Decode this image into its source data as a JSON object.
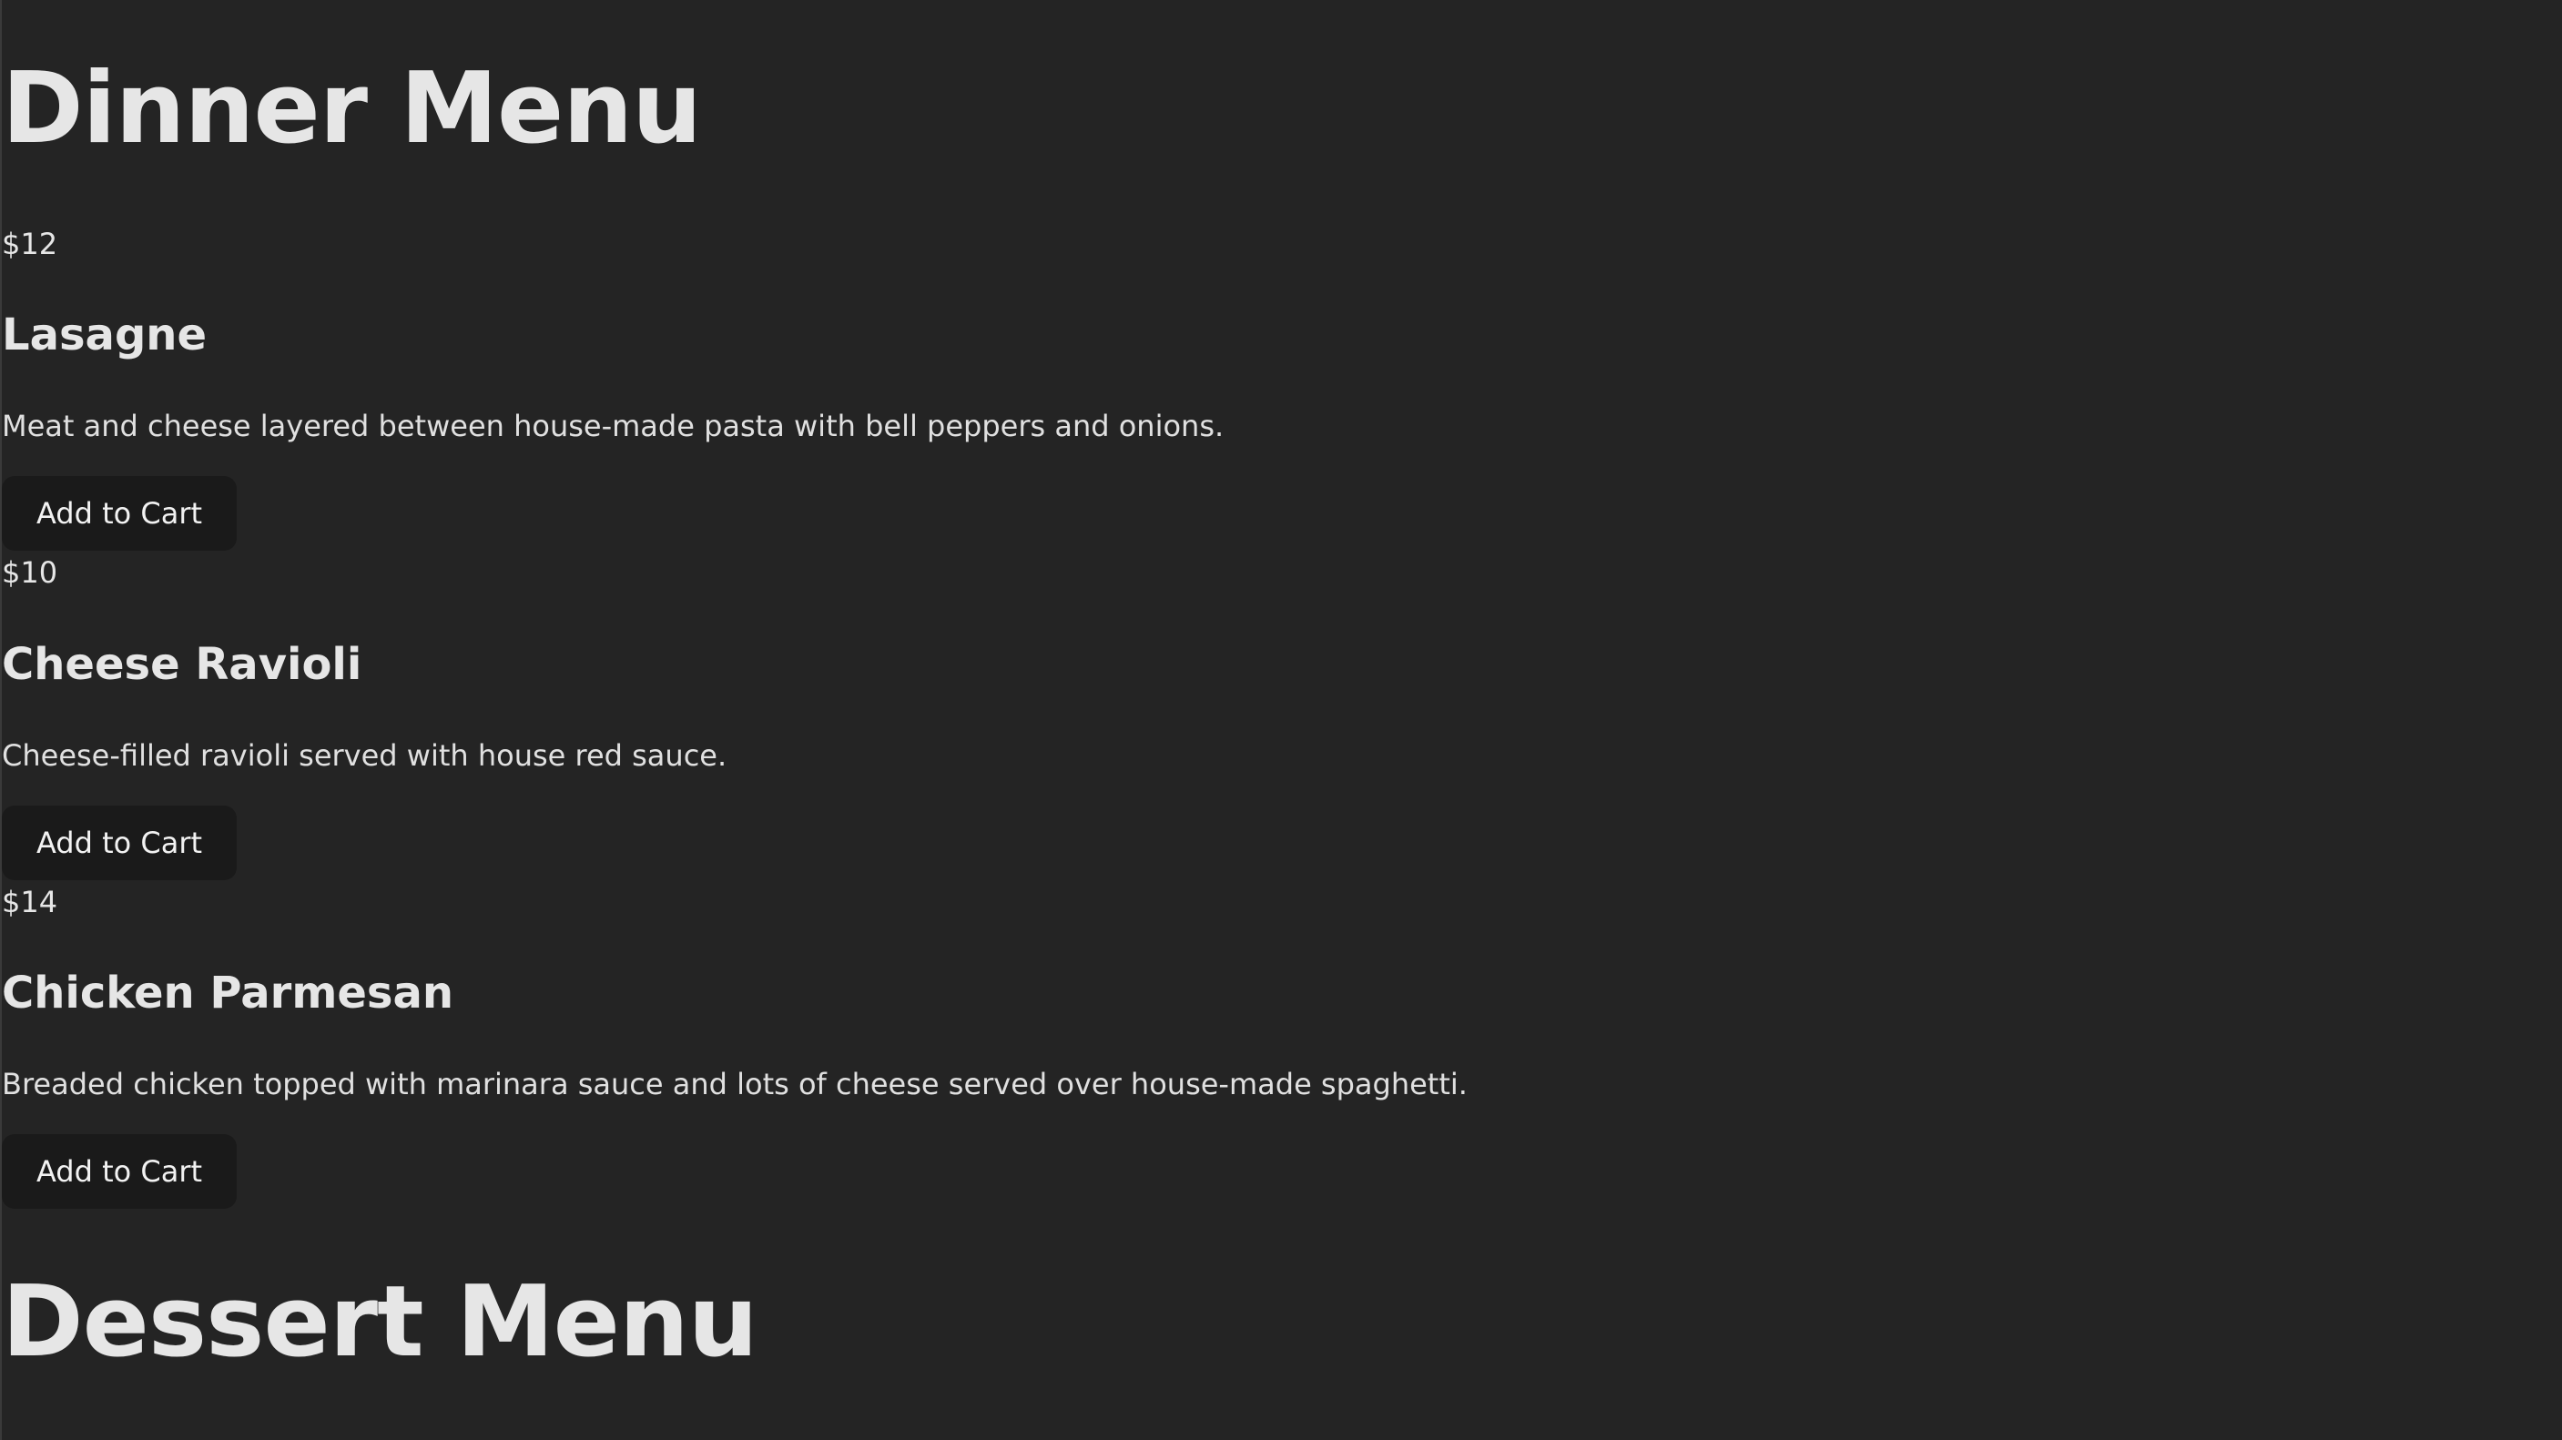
{
  "dinner_menu": {
    "title": "Dinner Menu",
    "items": [
      {
        "price": "$12",
        "name": "Lasagne",
        "description": "Meat and cheese layered between house-made pasta with bell peppers and onions.",
        "button_label": "Add to Cart"
      },
      {
        "price": "$10",
        "name": "Cheese Ravioli",
        "description": "Cheese-filled ravioli served with house red sauce.",
        "button_label": "Add to Cart"
      },
      {
        "price": "$14",
        "name": "Chicken Parmesan",
        "description": "Breaded chicken topped with marinara sauce and lots of cheese served over house-made spaghetti.",
        "button_label": "Add to Cart"
      }
    ]
  },
  "dessert_menu": {
    "title": "Dessert Menu"
  }
}
